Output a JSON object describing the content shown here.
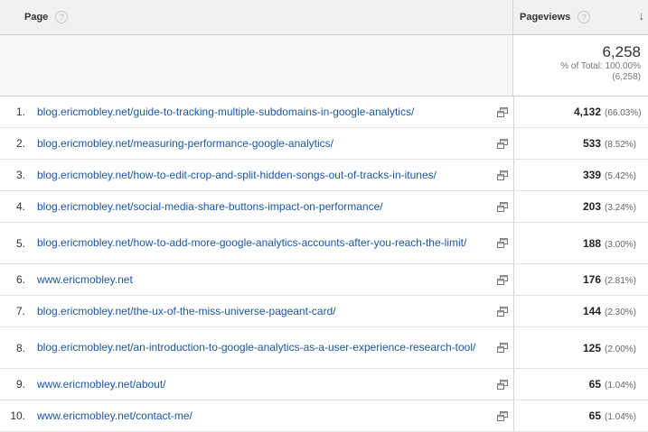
{
  "header": {
    "page_label": "Page",
    "help_glyph": "?",
    "pageviews_label": "Pageviews",
    "sort_glyph": "↓"
  },
  "totals": {
    "value": "6,258",
    "pct_line": "% of Total: 100.00%",
    "abs_line": "(6,258)"
  },
  "rows": [
    {
      "index": "1.",
      "url": "blog.ericmobley.net/guide-to-tracking-multiple-subdomains-in-google-analytics/",
      "views": "4,132",
      "pct": "(66.03%)"
    },
    {
      "index": "2.",
      "url": "blog.ericmobley.net/measuring-performance-google-analytics/",
      "views": "533",
      "pct": "(8.52%)"
    },
    {
      "index": "3.",
      "url": "blog.ericmobley.net/how-to-edit-crop-and-split-hidden-songs-out-of-tracks-in-itunes/",
      "views": "339",
      "pct": "(5.42%)"
    },
    {
      "index": "4.",
      "url": "blog.ericmobley.net/social-media-share-buttons-impact-on-performance/",
      "views": "203",
      "pct": "(3.24%)"
    },
    {
      "index": "5.",
      "url": "blog.ericmobley.net/how-to-add-more-google-analytics-accounts-after-you-reach-the-limit/",
      "views": "188",
      "pct": "(3.00%)"
    },
    {
      "index": "6.",
      "url": "www.ericmobley.net",
      "views": "176",
      "pct": "(2.81%)"
    },
    {
      "index": "7.",
      "url": "blog.ericmobley.net/the-ux-of-the-miss-universe-pageant-card/",
      "views": "144",
      "pct": "(2.30%)"
    },
    {
      "index": "8.",
      "url": "blog.ericmobley.net/an-introduction-to-google-analytics-as-a-user-experience-research-tool/",
      "views": "125",
      "pct": "(2.00%)"
    },
    {
      "index": "9.",
      "url": "www.ericmobley.net/about/",
      "views": "65",
      "pct": "(1.04%)"
    },
    {
      "index": "10.",
      "url": "www.ericmobley.net/contact-me/",
      "views": "65",
      "pct": "(1.04%)"
    }
  ],
  "icons": {
    "help": "help-icon",
    "sort": "sort-descending-icon",
    "external": "open-in-new-window-icon"
  }
}
